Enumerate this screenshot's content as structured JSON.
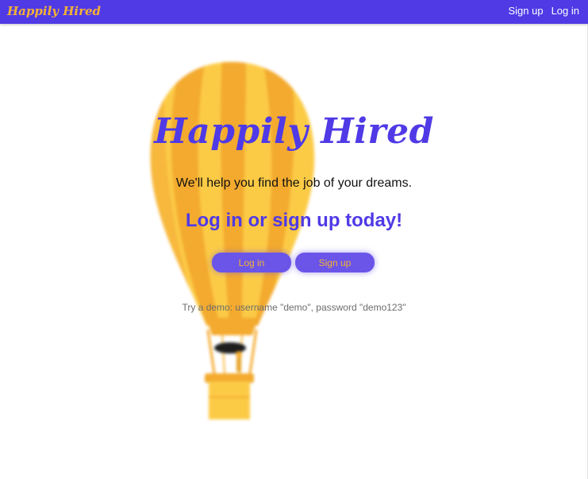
{
  "navbar": {
    "brand": "Happily Hired",
    "links": [
      "Sign up",
      "Log in"
    ]
  },
  "hero": {
    "title": "Happily Hired",
    "tagline": "We'll help you find the job of your dreams.",
    "cta_heading": "Log in or sign up today!",
    "buttons": {
      "login": "Log in",
      "signup": "Sign up"
    },
    "demo_note": "Try a demo: username \"demo\", password \"demo123\""
  },
  "colors": {
    "primary": "#4f3ae6",
    "accent": "#f6b234",
    "balloon_orange": "#f3a623",
    "balloon_yellow": "#fcc93d"
  },
  "icons": [
    "hot-air-balloon-illustration"
  ]
}
